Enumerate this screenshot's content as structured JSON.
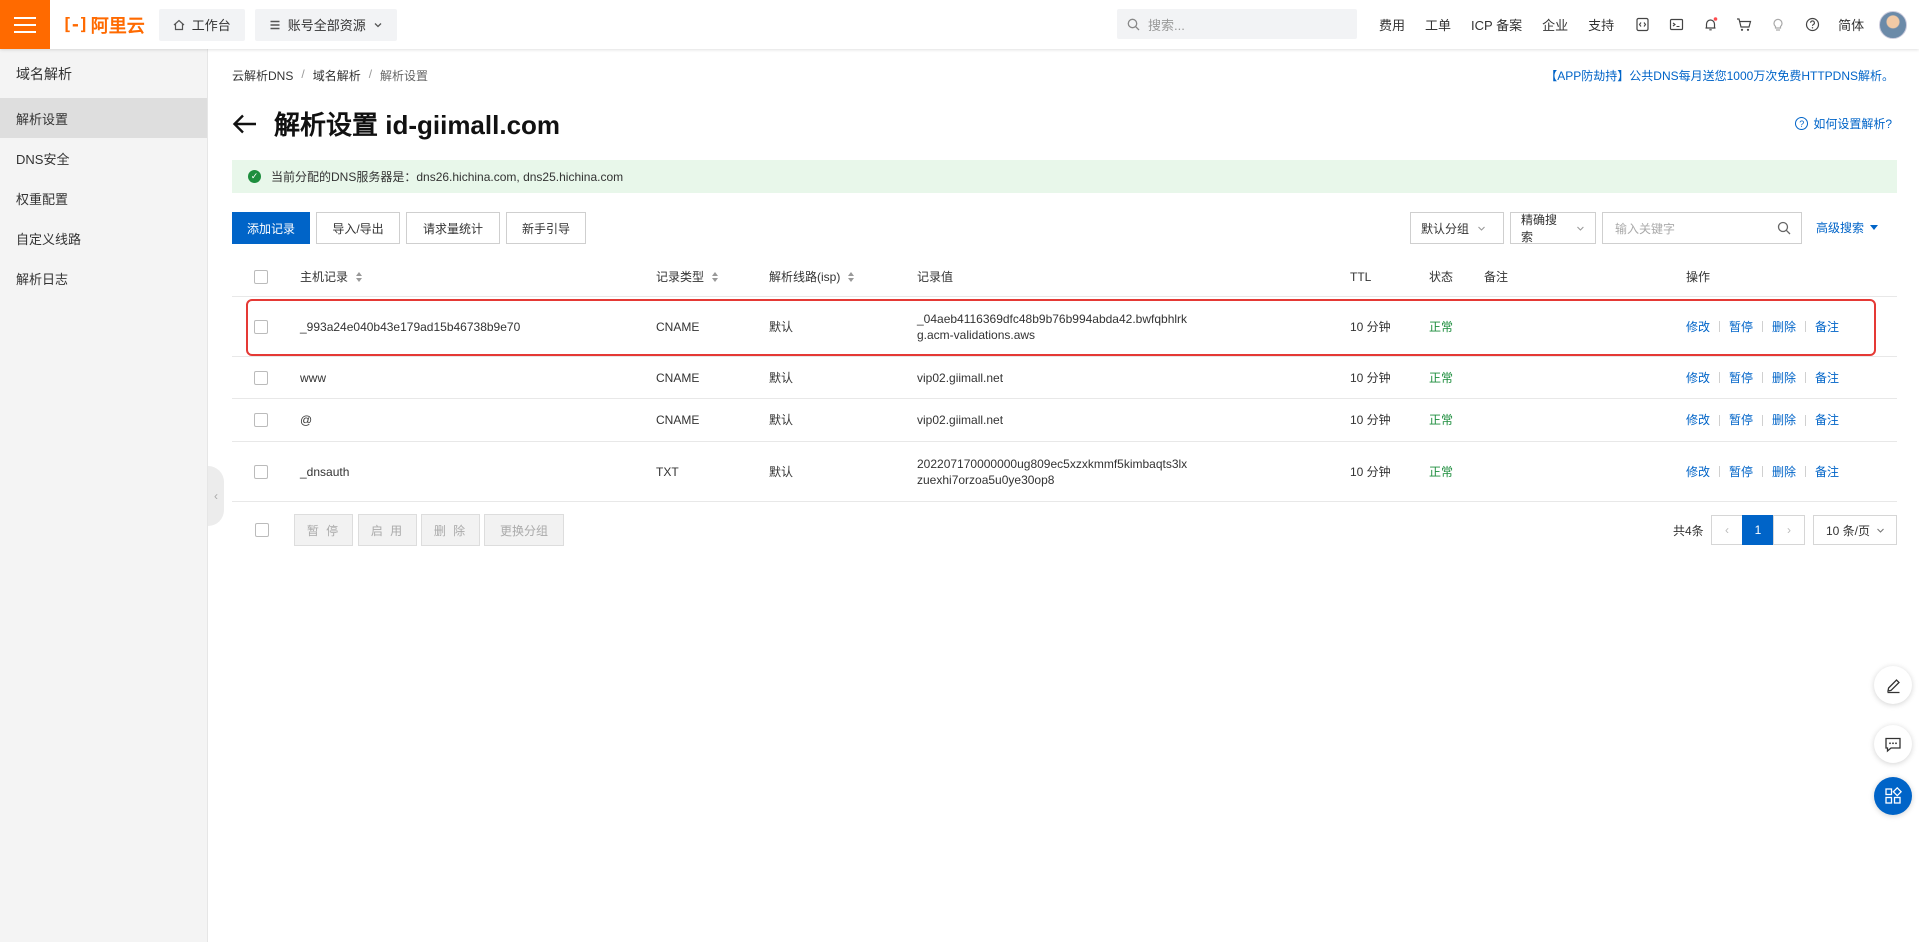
{
  "topbar": {
    "logo_text": "阿里云",
    "workbench_label": "工作台",
    "resources_label": "账号全部资源",
    "search_placeholder": "搜索...",
    "links": [
      "费用",
      "工单",
      "ICP 备案",
      "企业",
      "支持"
    ],
    "lang_label": "简体",
    "accent_color": "#ff6a00"
  },
  "sidebar": {
    "title": "域名解析",
    "items": [
      {
        "label": "解析设置",
        "active": true
      },
      {
        "label": "DNS安全",
        "active": false
      },
      {
        "label": "权重配置",
        "active": false
      },
      {
        "label": "自定义线路",
        "active": false
      },
      {
        "label": "解析日志",
        "active": false
      }
    ]
  },
  "breadcrumb": [
    "云解析DNS",
    "域名解析",
    "解析设置"
  ],
  "promo_text": "【APP防劫持】公共DNS每月送您1000万次免费HTTPDNS解析。",
  "page_title": "解析设置 id-giimall.com",
  "help_link": "如何设置解析?",
  "alert": {
    "label": "当前分配的DNS服务器是：",
    "servers": "dns26.hichina.com, dns25.hichina.com"
  },
  "toolbar": {
    "add_record": "添加记录",
    "import_export": "导入/导出",
    "request_stats": "请求量统计",
    "guide": "新手引导",
    "group_select": "默认分组",
    "search_mode": "精确搜索",
    "keyword_placeholder": "输入关键字",
    "advanced_search": "高级搜索"
  },
  "table": {
    "headers": {
      "host": "主机记录",
      "type": "记录类型",
      "line": "解析线路(isp)",
      "value": "记录值",
      "ttl": "TTL",
      "status": "状态",
      "remark": "备注",
      "actions": "操作"
    },
    "rows": [
      {
        "host": "_993a24e040b43e179ad15b46738b9e70",
        "type": "CNAME",
        "line": "默认",
        "value_line1": "_04aeb4116369dfc48b9b76b994abda42.bwfqbhlrk",
        "value_line2": "g.acm-validations.aws",
        "ttl": "10 分钟",
        "status": "正常",
        "remark": ""
      },
      {
        "host": "www",
        "type": "CNAME",
        "line": "默认",
        "value_line1": "vip02.giimall.net",
        "value_line2": "",
        "ttl": "10 分钟",
        "status": "正常",
        "remark": ""
      },
      {
        "host": "@",
        "type": "CNAME",
        "line": "默认",
        "value_line1": "vip02.giimall.net",
        "value_line2": "",
        "ttl": "10 分钟",
        "status": "正常",
        "remark": ""
      },
      {
        "host": "_dnsauth",
        "type": "TXT",
        "line": "默认",
        "value_line1": "202207170000000ug809ec5xzxkmmf5kimbaqts3lx",
        "value_line2": "zuexhi7orzoa5u0ye30op8",
        "ttl": "10 分钟",
        "status": "正常",
        "remark": ""
      }
    ],
    "actions": [
      "修改",
      "暂停",
      "删除",
      "备注"
    ],
    "highlight_color": "#e53935",
    "status_color": "#1e8e3e"
  },
  "bulk": {
    "pause": "暂 停",
    "enable": "启 用",
    "delete": "删 除",
    "change_group": "更换分组"
  },
  "pagination": {
    "total": "共4条",
    "current_page": "1",
    "per_page": "10 条/页"
  },
  "link_color": "#0064c8"
}
